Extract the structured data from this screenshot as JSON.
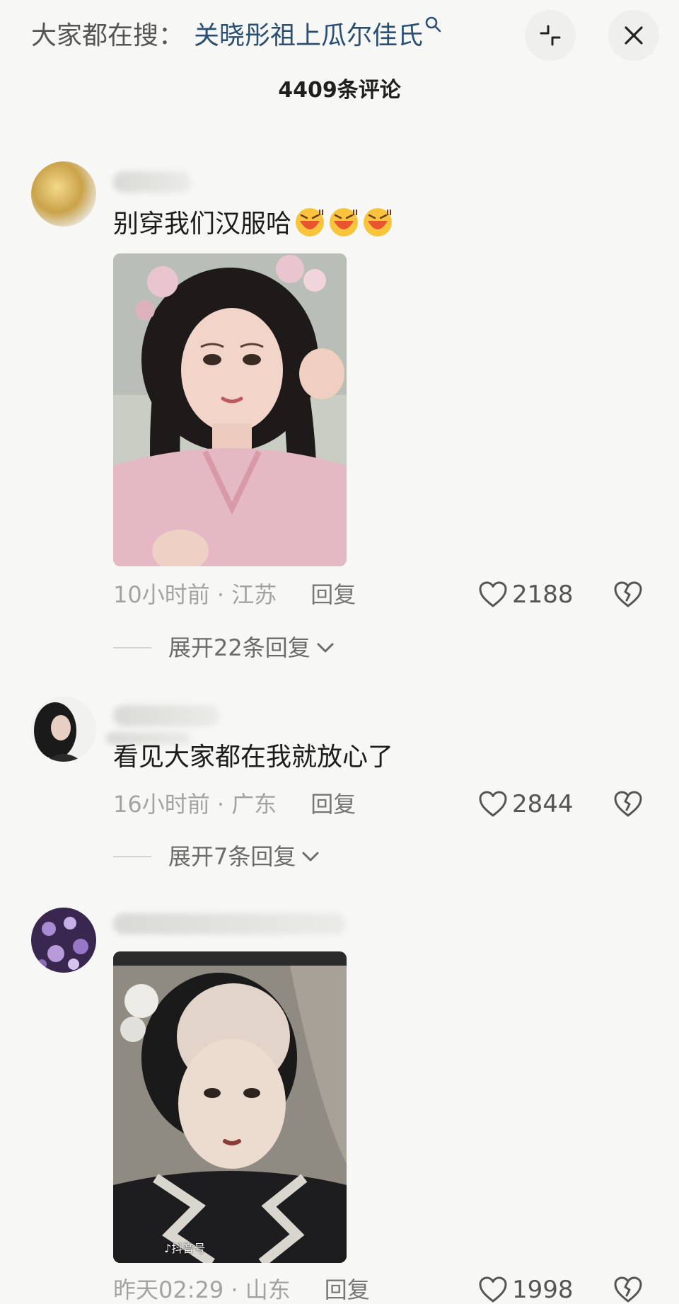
{
  "header": {
    "search_prefix": "大家都在搜：",
    "search_term": "关晓彤祖上瓜尔佳氏",
    "comment_count": "4409条评论"
  },
  "comments": [
    {
      "text": "别穿我们汉服哈",
      "time": "10小时前",
      "location": "江苏",
      "reply_label": "回复",
      "likes": "2188",
      "expand_label": "展开22条回复"
    },
    {
      "text": "看见大家都在我就放心了",
      "time": "16小时前",
      "location": "广东",
      "reply_label": "回复",
      "likes": "2844",
      "expand_label": "展开7条回复"
    },
    {
      "text": "",
      "time": "昨天02:29",
      "location": "山东",
      "reply_label": "回复",
      "likes": "1998",
      "watermark": "抖音号"
    }
  ],
  "separator": " · "
}
